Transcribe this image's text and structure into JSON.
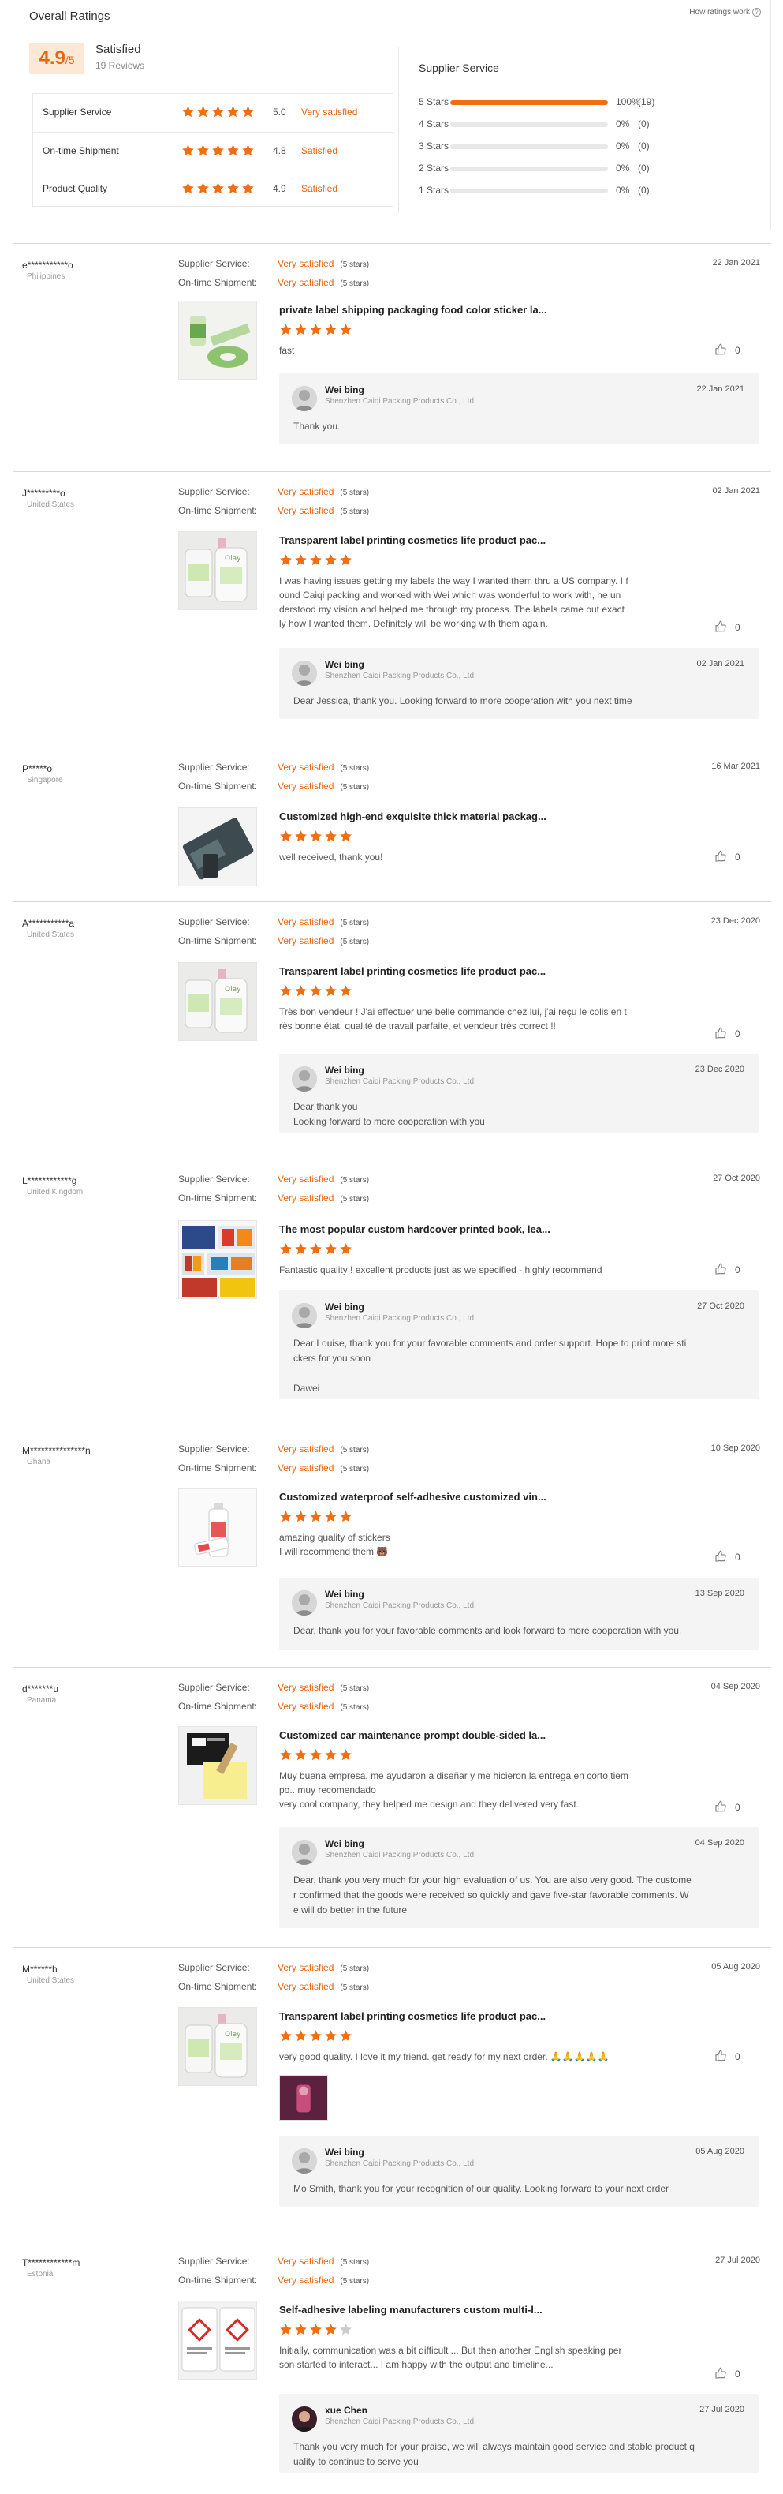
{
  "overall": {
    "title": "Overall Ratings",
    "how_link": "How ratings work",
    "score": "4.9",
    "score_suffix": "/5",
    "satisfaction": "Satisfied",
    "reviews_count": "19 Reviews",
    "metrics": [
      {
        "label": "Supplier Service",
        "value": "5.0",
        "desc": "Very satisfied",
        "stars": 5
      },
      {
        "label": "On-time Shipment",
        "value": "4.8",
        "desc": "Satisfied",
        "stars": 5
      },
      {
        "label": "Product Quality",
        "value": "4.9",
        "desc": "Satisfied",
        "stars": 5
      }
    ],
    "distribution_title": "Supplier Service",
    "distribution": [
      {
        "label": "5 Stars",
        "pct": "100%",
        "count": "(19)",
        "fraction": 1.0
      },
      {
        "label": "4 Stars",
        "pct": "0%",
        "count": "(0)",
        "fraction": 0
      },
      {
        "label": "3 Stars",
        "pct": "0%",
        "count": "(0)",
        "fraction": 0
      },
      {
        "label": "2 Stars",
        "pct": "0%",
        "count": "(0)",
        "fraction": 0
      },
      {
        "label": "1 Stars",
        "pct": "0%",
        "count": "(0)",
        "fraction": 0
      }
    ],
    "accent_color": "#e8640f"
  },
  "labels": {
    "supplier_service": "Supplier Service:",
    "on_time_shipment": "On-time Shipment:",
    "five_stars": "(5 stars)"
  },
  "reviews": [
    {
      "name": "e***********o",
      "country": "Philippines",
      "date": "22 Jan 2021",
      "service": "Very satisfied",
      "shipment": "Very satisfied",
      "product_title": "private label shipping packaging food color sticker la...",
      "stars": 5,
      "text": "fast",
      "helpful": "0",
      "thumb": "sticker-rolls",
      "reply": {
        "name": "Wei bing",
        "company": "Shenzhen Caiqi Packing Products Co., Ltd.",
        "date": "22 Jan 2021",
        "text": "Thank you."
      }
    },
    {
      "name": "J*********o",
      "country": "United States",
      "date": "02 Jan 2021",
      "service": "Very satisfied",
      "shipment": "Very satisfied",
      "product_title": "Transparent label printing cosmetics life product pac...",
      "stars": 5,
      "text": "I was having issues getting my labels the way I wanted  them thru a US company. I f\nound Caiqi packing and worked with Wei which was wonderful to work with, he un\nderstood my vision and helped me through my process. The labels came out exact\nly how I wanted them. Definitely will be working with them again.",
      "helpful": "0",
      "thumb": "cosmetic-bottles",
      "reply": {
        "name": "Wei bing",
        "company": "Shenzhen Caiqi Packing Products Co., Ltd.",
        "date": "02 Jan 2021",
        "text": "Dear Jessica, thank you. Looking forward to more cooperation with you next time"
      }
    },
    {
      "name": "P*****o",
      "country": "Singapore",
      "date": "16 Mar 2021",
      "service": "Very satisfied",
      "shipment": "Very satisfied",
      "product_title": "Customized high-end exquisite thick material packag...",
      "stars": 5,
      "text": "well received, thank you!",
      "helpful": "0",
      "thumb": "dark-pouch"
    },
    {
      "name": "A***********a",
      "country": "United States",
      "date": "23 Dec 2020",
      "service": "Very satisfied",
      "shipment": "Very satisfied",
      "product_title": "Transparent label printing cosmetics life product pac...",
      "stars": 5,
      "text": "Très bon vendeur ! J'ai effectuer une belle commande chez lui, j'ai reçu le colis en t\nrès bonne état, qualité de travail parfaite, et vendeur très correct !!",
      "helpful": "0",
      "thumb": "cosmetic-bottles",
      "reply": {
        "name": "Wei bing",
        "company": "Shenzhen Caiqi Packing Products Co., Ltd.",
        "date": "23 Dec 2020",
        "text": "Dear  thank you\nLooking forward to more cooperation with you"
      }
    },
    {
      "name": "L************g",
      "country": "United Kingdom",
      "date": "27 Oct 2020",
      "service": "Very satisfied",
      "shipment": "Very satisfied",
      "product_title": "The most popular custom hardcover printed book, lea...",
      "stars": 5,
      "text": "Fantastic quality !  excellent products just as we specified - highly recommend",
      "helpful": "0",
      "thumb": "books",
      "reply": {
        "name": "Wei bing",
        "company": "Shenzhen Caiqi Packing Products Co., Ltd.",
        "date": "27 Oct 2020",
        "text": "Dear Louise, thank you for your favorable comments and order support. Hope to print more sti\nckers for you soon\n\nDawei"
      }
    },
    {
      "name": "M***************n",
      "country": "Ghana",
      "date": "10 Sep 2020",
      "service": "Very satisfied",
      "shipment": "Very satisfied",
      "product_title": "Customized waterproof self-adhesive customized vin...",
      "stars": 5,
      "text": "amazing quality of stickers\nI will recommend them 🐻",
      "helpful": "0",
      "thumb": "spray-bottle",
      "reply": {
        "name": "Wei bing",
        "company": "Shenzhen Caiqi Packing Products Co., Ltd.",
        "date": "13 Sep 2020",
        "text": "Dear, thank you for your favorable comments and look forward to more cooperation with you."
      }
    },
    {
      "name": "d*******u",
      "country": "Panama",
      "date": "04 Sep 2020",
      "service": "Very satisfied",
      "shipment": "Very satisfied",
      "product_title": "Customized car maintenance prompt double-sided la...",
      "stars": 5,
      "text": "Muy buena empresa, me ayudaron a diseñar y me hicieron la entrega en corto tiem\npo.. muy recomendado\nvery cool company, they helped me design and they delivered very fast.",
      "helpful": "0",
      "thumb": "car-labels",
      "reply": {
        "name": "Wei bing",
        "company": "Shenzhen Caiqi Packing Products Co., Ltd.",
        "date": "04 Sep 2020",
        "text": "Dear, thank you very much for your high evaluation of us. You are also very good. The custome\nr confirmed that the goods were received so quickly and gave five-star favorable comments. W\ne will do better in the future"
      }
    },
    {
      "name": "M******h",
      "country": "United States",
      "date": "05 Aug 2020",
      "service": "Very satisfied",
      "shipment": "Very satisfied",
      "product_title": "Transparent label printing cosmetics life product pac...",
      "stars": 5,
      "text": "very good quality. I love it my friend. get ready for my next order. 🙏🙏🙏🙏🙏",
      "helpful": "0",
      "thumb": "cosmetic-bottles",
      "reply": {
        "name": "Wei bing",
        "company": "Shenzhen Caiqi Packing Products Co., Ltd.",
        "date": "05 Aug 2020",
        "text": "Mo Smith, thank you for your recognition of our quality. Looking forward to your next order"
      }
    },
    {
      "name": "T************m",
      "country": "Estonia",
      "date": "27 Jul 2020",
      "service": "Very satisfied",
      "shipment": "Very satisfied",
      "product_title": "Self-adhesive labeling manufacturers custom multi-l...",
      "stars": 4,
      "text": "Initially, communication was a bit difficult ... But then another English speaking per\nson started to interact... I am happy with the output and timeline...",
      "helpful": "0",
      "thumb": "warning-labels",
      "reply": {
        "name": "xue Chen",
        "company": "Shenzhen Caiqi Packing Products Co., Ltd.",
        "date": "27 Jul 2020",
        "text": "Thank you very much for your praise, we will always maintain good service and stable product q\nuality to continue to serve you"
      }
    }
  ]
}
